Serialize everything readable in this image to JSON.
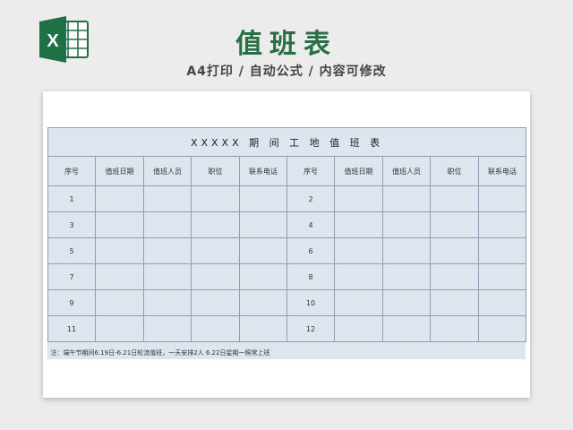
{
  "header": {
    "logo_letter": "X",
    "title": "值班表",
    "subtitle": "A4打印 / 自动公式 / 内容可修改",
    "brand_color": "#2a6e45",
    "logo_color": "#1e7145"
  },
  "sheet": {
    "table_title": "XXXXX 期 间 工 地 值 班 表",
    "columns": [
      "序号",
      "值班日期",
      "值班人员",
      "职位",
      "联系电话",
      "序号",
      "值班日期",
      "值班人员",
      "职位",
      "联系电话"
    ],
    "rows": [
      {
        "left_no": "1",
        "right_no": "2"
      },
      {
        "left_no": "3",
        "right_no": "4"
      },
      {
        "left_no": "5",
        "right_no": "6"
      },
      {
        "left_no": "7",
        "right_no": "8"
      },
      {
        "left_no": "9",
        "right_no": "10"
      },
      {
        "left_no": "11",
        "right_no": "12"
      }
    ],
    "note": "注：端午节期间6.19日-6.21日轮流值班，一天安排2人   6.22日星期一照常上班",
    "grid_color": "#8c9fb3",
    "fill_color": "#dde5ee"
  }
}
